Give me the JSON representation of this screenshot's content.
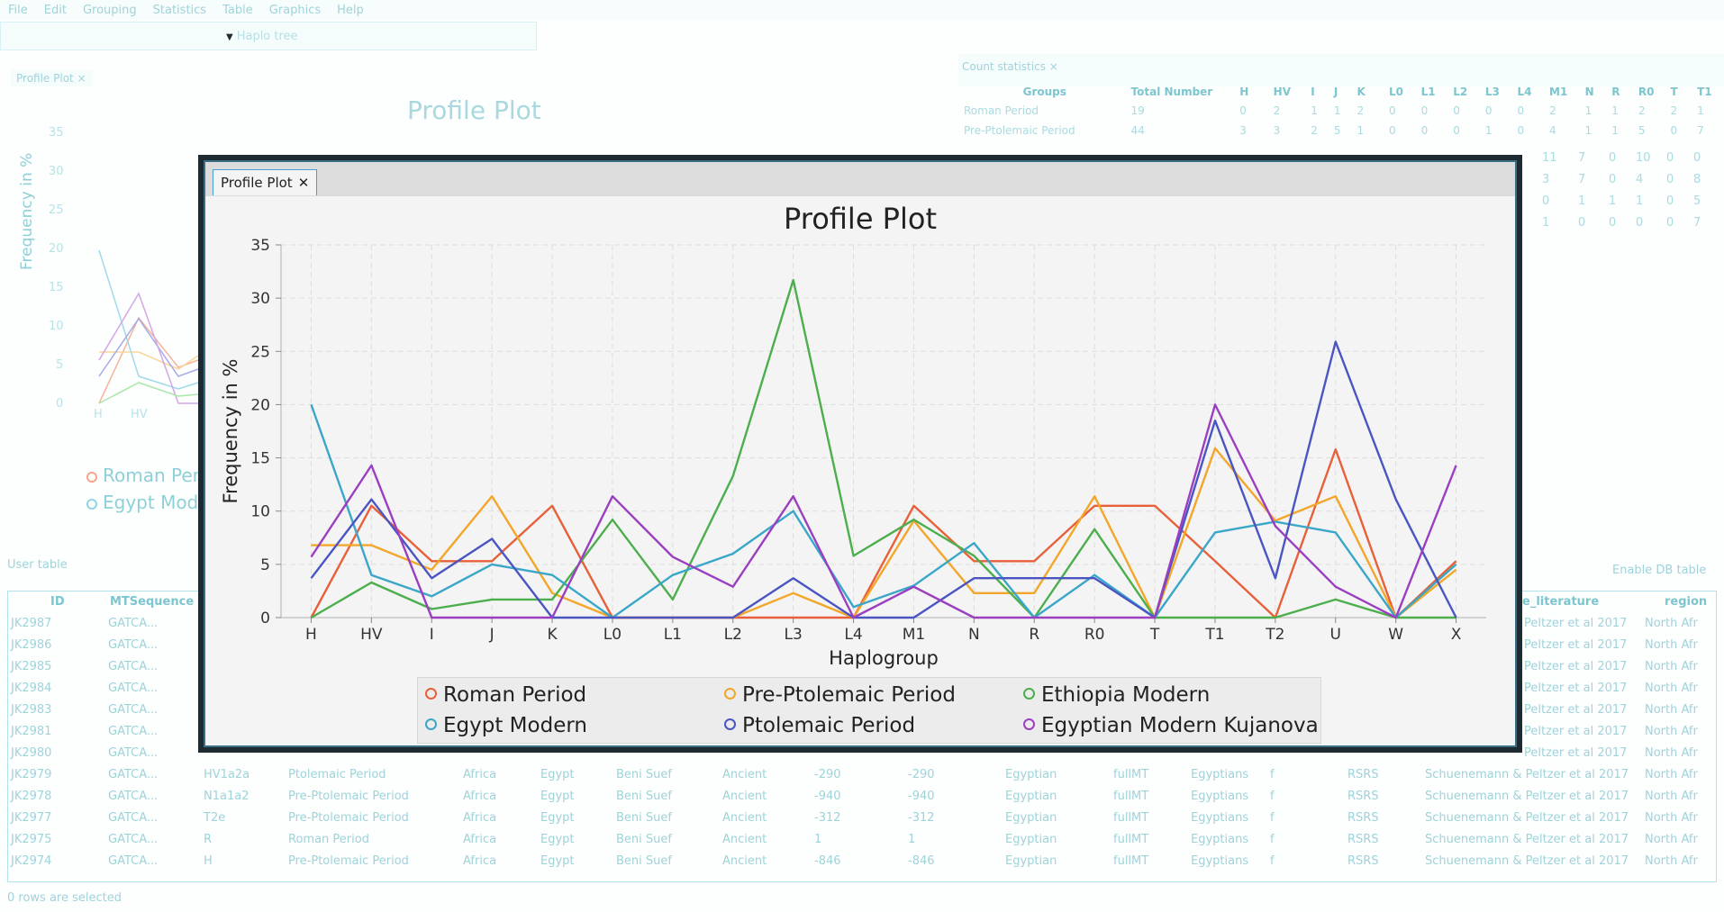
{
  "menu": [
    "File",
    "Edit",
    "Grouping",
    "Statistics",
    "Table",
    "Graphics",
    "Help"
  ],
  "haplo_tree": "Haplo tree",
  "background_plot": {
    "tab": "Profile Plot",
    "title": "Profile Plot",
    "ylabel": "Frequency in %",
    "yticks": [
      "35",
      "30",
      "25",
      "20",
      "15",
      "10",
      "5",
      "0"
    ],
    "xticks": [
      "H",
      "HV",
      "I"
    ],
    "legend": [
      "Roman Period",
      "Egypt Modern"
    ]
  },
  "count_statistics": {
    "tab": "Count statistics",
    "headers": [
      "Groups",
      "Total Number",
      "H",
      "HV",
      "I",
      "J",
      "K",
      "L0",
      "L1",
      "L2",
      "L3",
      "L4",
      "M1",
      "N",
      "R",
      "R0",
      "T",
      "T1"
    ],
    "rows": [
      [
        "Roman Period",
        "19",
        "0",
        "2",
        "1",
        "1",
        "2",
        "0",
        "0",
        "0",
        "0",
        "0",
        "2",
        "1",
        "1",
        "2",
        "2",
        "1"
      ],
      [
        "Pre-Ptolemaic Period",
        "44",
        "3",
        "3",
        "2",
        "5",
        "1",
        "0",
        "0",
        "0",
        "1",
        "0",
        "4",
        "1",
        "1",
        "5",
        "0",
        "7"
      ]
    ],
    "tail_rows": [
      [
        "11",
        "7",
        "0",
        "10",
        "0",
        "0"
      ],
      [
        "3",
        "7",
        "0",
        "4",
        "0",
        "8"
      ],
      [
        "0",
        "1",
        "1",
        "1",
        "0",
        "5"
      ],
      [
        "1",
        "0",
        "0",
        "0",
        "0",
        "7"
      ]
    ]
  },
  "user_table": {
    "label": "User table",
    "enable_db": "Enable DB table",
    "status": "0 rows are selected",
    "headers": {
      "id": "ID",
      "seq": "MTSequence",
      "lit": "e_literature",
      "region": "region"
    },
    "rows": [
      {
        "id": "JK2987",
        "seq": "GATCA...",
        "lit": "Peltzer et al 2017",
        "region": "North Afr"
      },
      {
        "id": "JK2986",
        "seq": "GATCA...",
        "lit": "Peltzer et al 2017",
        "region": "North Afr"
      },
      {
        "id": "JK2985",
        "seq": "GATCA...",
        "lit": "Peltzer et al 2017",
        "region": "North Afr"
      },
      {
        "id": "JK2984",
        "seq": "GATCA...",
        "lit": "Peltzer et al 2017",
        "region": "North Afr"
      },
      {
        "id": "JK2983",
        "seq": "GATCA...",
        "lit": "Peltzer et al 2017",
        "region": "North Afr"
      },
      {
        "id": "JK2981",
        "seq": "GATCA...",
        "lit": "Peltzer et al 2017",
        "region": "North Afr"
      },
      {
        "id": "JK2980",
        "seq": "GATCA...",
        "lit": "Peltzer et al 2017",
        "region": "North Afr"
      }
    ],
    "full_rows": [
      {
        "id": "JK2979",
        "seq": "GATCA...",
        "hg": "HV1a2a",
        "period": "Ptolemaic Period",
        "cont": "Africa",
        "country": "Egypt",
        "loc": "Beni Suef",
        "age": "Ancient",
        "d1": "-290",
        "d2": "-290",
        "pop": "Egyptian",
        "type": "fullMT",
        "group": "Egyptians",
        "sex": "f",
        "ref": "RSRS",
        "lit": "Schuenemann & Peltzer et al 2017",
        "region": "North Afr"
      },
      {
        "id": "JK2978",
        "seq": "GATCA...",
        "hg": "N1a1a2",
        "period": "Pre-Ptolemaic Period",
        "cont": "Africa",
        "country": "Egypt",
        "loc": "Beni Suef",
        "age": "Ancient",
        "d1": "-940",
        "d2": "-940",
        "pop": "Egyptian",
        "type": "fullMT",
        "group": "Egyptians",
        "sex": "f",
        "ref": "RSRS",
        "lit": "Schuenemann & Peltzer et al 2017",
        "region": "North Afr"
      },
      {
        "id": "JK2977",
        "seq": "GATCA...",
        "hg": "T2e",
        "period": "Pre-Ptolemaic Period",
        "cont": "Africa",
        "country": "Egypt",
        "loc": "Beni Suef",
        "age": "Ancient",
        "d1": "-312",
        "d2": "-312",
        "pop": "Egyptian",
        "type": "fullMT",
        "group": "Egyptians",
        "sex": "f",
        "ref": "RSRS",
        "lit": "Schuenemann & Peltzer et al 2017",
        "region": "North Afr"
      },
      {
        "id": "JK2975",
        "seq": "GATCA...",
        "hg": "R",
        "period": "Roman Period",
        "cont": "Africa",
        "country": "Egypt",
        "loc": "Beni Suef",
        "age": "Ancient",
        "d1": "1",
        "d2": "1",
        "pop": "Egyptian",
        "type": "fullMT",
        "group": "Egyptians",
        "sex": "f",
        "ref": "RSRS",
        "lit": "Schuenemann & Peltzer et al 2017",
        "region": "North Afr"
      },
      {
        "id": "JK2974",
        "seq": "GATCA...",
        "hg": "H",
        "period": "Pre-Ptolemaic Period",
        "cont": "Africa",
        "country": "Egypt",
        "loc": "Beni Suef",
        "age": "Ancient",
        "d1": "-846",
        "d2": "-846",
        "pop": "Egyptian",
        "type": "fullMT",
        "group": "Egyptians",
        "sex": "f",
        "ref": "RSRS",
        "lit": "Schuenemann & Peltzer et al 2017",
        "region": "North Afr"
      }
    ]
  },
  "dialog": {
    "tab": "Profile Plot",
    "close_glyph": "✕"
  },
  "chart_data": {
    "type": "line",
    "title": "Profile Plot",
    "xlabel": "Haplogroup",
    "ylabel": "Frequency in %",
    "ylim": [
      0,
      35
    ],
    "yticks": [
      0,
      5,
      10,
      15,
      20,
      25,
      30,
      35
    ],
    "grid": true,
    "legend_position": "bottom",
    "categories": [
      "H",
      "HV",
      "I",
      "J",
      "K",
      "L0",
      "L1",
      "L2",
      "L3",
      "L4",
      "M1",
      "N",
      "R",
      "R0",
      "T",
      "T1",
      "T2",
      "U",
      "W",
      "X"
    ],
    "series": [
      {
        "name": "Roman Period",
        "color": "#e8603a",
        "values": [
          0,
          10.5,
          5.3,
          5.3,
          10.5,
          0,
          0,
          0,
          0,
          0,
          10.5,
          5.3,
          5.3,
          10.5,
          10.5,
          5.3,
          0,
          15.8,
          0,
          5.3
        ]
      },
      {
        "name": "Pre-Ptolemaic Period",
        "color": "#f2a62a",
        "values": [
          6.8,
          6.8,
          4.5,
          11.4,
          2.3,
          0,
          0,
          0,
          2.3,
          0,
          9.1,
          2.3,
          2.3,
          11.4,
          0,
          15.9,
          9.1,
          11.4,
          0,
          4.5
        ]
      },
      {
        "name": "Ethiopia Modern",
        "color": "#4cae4c",
        "values": [
          0,
          3.3,
          0.8,
          1.7,
          1.7,
          9.2,
          1.7,
          13.3,
          31.7,
          5.8,
          9.2,
          5.8,
          0,
          8.3,
          0,
          0,
          0,
          1.7,
          0,
          0
        ]
      },
      {
        "name": "Egypt Modern",
        "color": "#3aa6c8",
        "values": [
          20,
          4,
          2,
          5,
          4,
          0,
          4,
          6,
          10,
          1,
          3,
          7,
          0,
          4,
          0,
          8,
          9,
          8,
          0,
          5
        ]
      },
      {
        "name": "Ptolemaic Period",
        "color": "#4a55c2",
        "values": [
          3.7,
          11.1,
          3.7,
          7.4,
          0,
          0,
          0,
          0,
          3.7,
          0,
          0,
          3.7,
          3.7,
          3.7,
          0,
          18.5,
          3.7,
          25.9,
          11.1,
          0
        ]
      },
      {
        "name": "Egyptian Modern Kujanova",
        "color": "#9a3fc0",
        "values": [
          5.7,
          14.3,
          0,
          0,
          0,
          11.4,
          5.7,
          2.9,
          11.4,
          0,
          2.9,
          0,
          0,
          0,
          0,
          20,
          8.6,
          2.9,
          0,
          14.3
        ]
      }
    ]
  }
}
